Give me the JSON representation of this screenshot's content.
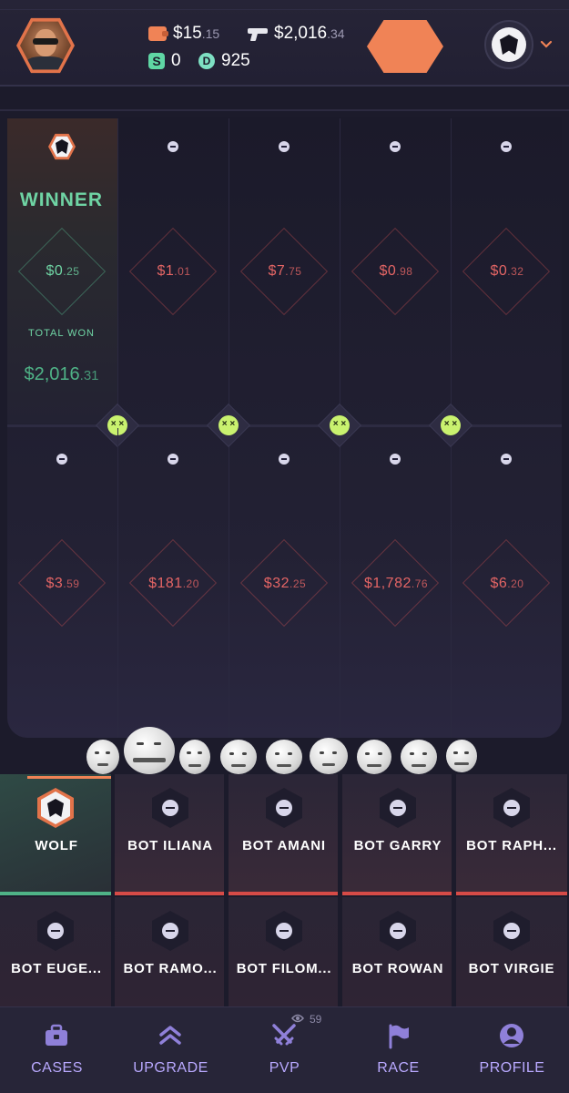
{
  "header": {
    "balances": [
      {
        "icon": "wallet-icon",
        "main": "$15",
        "cents": ".15"
      },
      {
        "icon": "gun-icon",
        "main": "$2,016",
        "cents": ".34"
      },
      {
        "icon": "s-badge-icon",
        "glyph": "S",
        "main": "0",
        "cents": ""
      },
      {
        "icon": "d-badge-icon",
        "glyph": "D",
        "main": "925",
        "cents": ""
      }
    ]
  },
  "battle": {
    "winner_label": "WINNER",
    "total_won_label": "TOTAL WON",
    "total_won": {
      "main": "$2,016",
      "cents": ".31"
    },
    "row1": [
      {
        "main": "$0",
        "cents": ".25",
        "win": true
      },
      {
        "main": "$1",
        "cents": ".01"
      },
      {
        "main": "$7",
        "cents": ".75"
      },
      {
        "main": "$0",
        "cents": ".98"
      },
      {
        "main": "$0",
        "cents": ".32"
      }
    ],
    "row2": [
      {
        "main": "$3",
        "cents": ".59"
      },
      {
        "main": "$181",
        "cents": ".20"
      },
      {
        "main": "$32",
        "cents": ".25"
      },
      {
        "main": "$1,782",
        "cents": ".76"
      },
      {
        "main": "$6",
        "cents": ".20"
      }
    ]
  },
  "players": [
    {
      "name": "WOLF",
      "active": true
    },
    {
      "name": "BOT ILIANA"
    },
    {
      "name": "BOT AMANI"
    },
    {
      "name": "BOT GARRY"
    },
    {
      "name": "BOT RAPH..."
    },
    {
      "name": "BOT EUGE..."
    },
    {
      "name": "BOT RAMO..."
    },
    {
      "name": "BOT FILOM..."
    },
    {
      "name": "BOT ROWAN"
    },
    {
      "name": "BOT VIRGIE"
    }
  ],
  "nav": {
    "items": [
      {
        "label": "CASES",
        "icon": "briefcase-icon"
      },
      {
        "label": "UPGRADE",
        "icon": "double-chevron-up-icon"
      },
      {
        "label": "PVP",
        "icon": "crossed-swords-icon"
      },
      {
        "label": "RACE",
        "icon": "flag-icon"
      },
      {
        "label": "PROFILE",
        "icon": "user-icon"
      }
    ],
    "pvp_viewers": "59"
  },
  "colors": {
    "accent": "#f08356",
    "win": "#6fd4a4",
    "loss": "#e46565",
    "nav_label": "#b9a9ff"
  }
}
